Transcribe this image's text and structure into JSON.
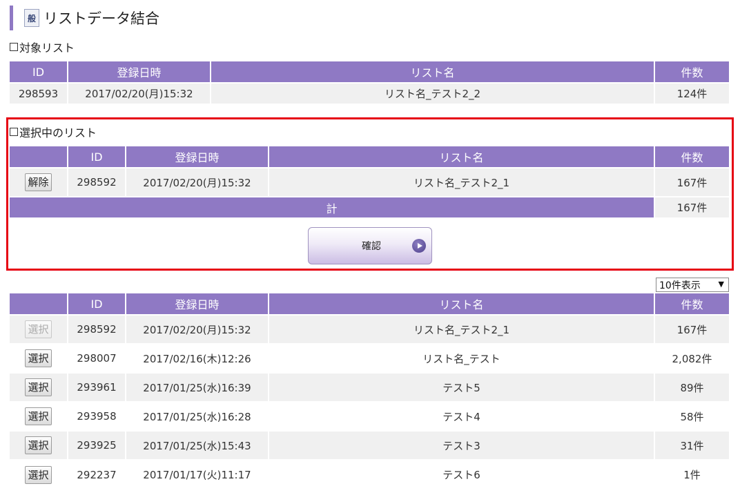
{
  "header": {
    "icon_text": "般",
    "title": "リストデータ結合"
  },
  "target_section": {
    "label": "対象リスト",
    "columns": [
      "ID",
      "登録日時",
      "リスト名",
      "件数"
    ],
    "rows": [
      {
        "id": "298593",
        "date": "2017/02/20(月)15:32",
        "name": "リスト名_テスト2_2",
        "count": "124件"
      }
    ]
  },
  "selected_section": {
    "label": "選択中のリスト",
    "columns": [
      "",
      "ID",
      "登録日時",
      "リスト名",
      "件数"
    ],
    "rows": [
      {
        "action": "解除",
        "id": "298592",
        "date": "2017/02/20(月)15:32",
        "name": "リスト名_テスト2_1",
        "count": "167件"
      }
    ],
    "total_label": "計",
    "total_count": "167件",
    "confirm_label": "確認"
  },
  "list_section": {
    "per_page": "10件表示",
    "columns": [
      "",
      "ID",
      "登録日時",
      "リスト名",
      "件数"
    ],
    "rows": [
      {
        "action": "選択",
        "id": "298592",
        "date": "2017/02/20(月)15:32",
        "name": "リスト名_テスト2_1",
        "count": "167件"
      },
      {
        "action": "選択",
        "id": "298007",
        "date": "2017/02/16(木)12:26",
        "name": "リスト名_テスト",
        "count": "2,082件"
      },
      {
        "action": "選択",
        "id": "293961",
        "date": "2017/01/25(水)16:39",
        "name": "テスト5",
        "count": "89件"
      },
      {
        "action": "選択",
        "id": "293958",
        "date": "2017/01/25(水)16:28",
        "name": "テスト4",
        "count": "58件"
      },
      {
        "action": "選択",
        "id": "293925",
        "date": "2017/01/25(水)15:43",
        "name": "テスト3",
        "count": "31件"
      },
      {
        "action": "選択",
        "id": "292237",
        "date": "2017/01/17(火)11:17",
        "name": "テスト6",
        "count": "1件"
      }
    ]
  },
  "colors": {
    "accent": "#8f79c4",
    "highlight_frame": "#e60012",
    "row_bg": "#f0f0f0"
  }
}
